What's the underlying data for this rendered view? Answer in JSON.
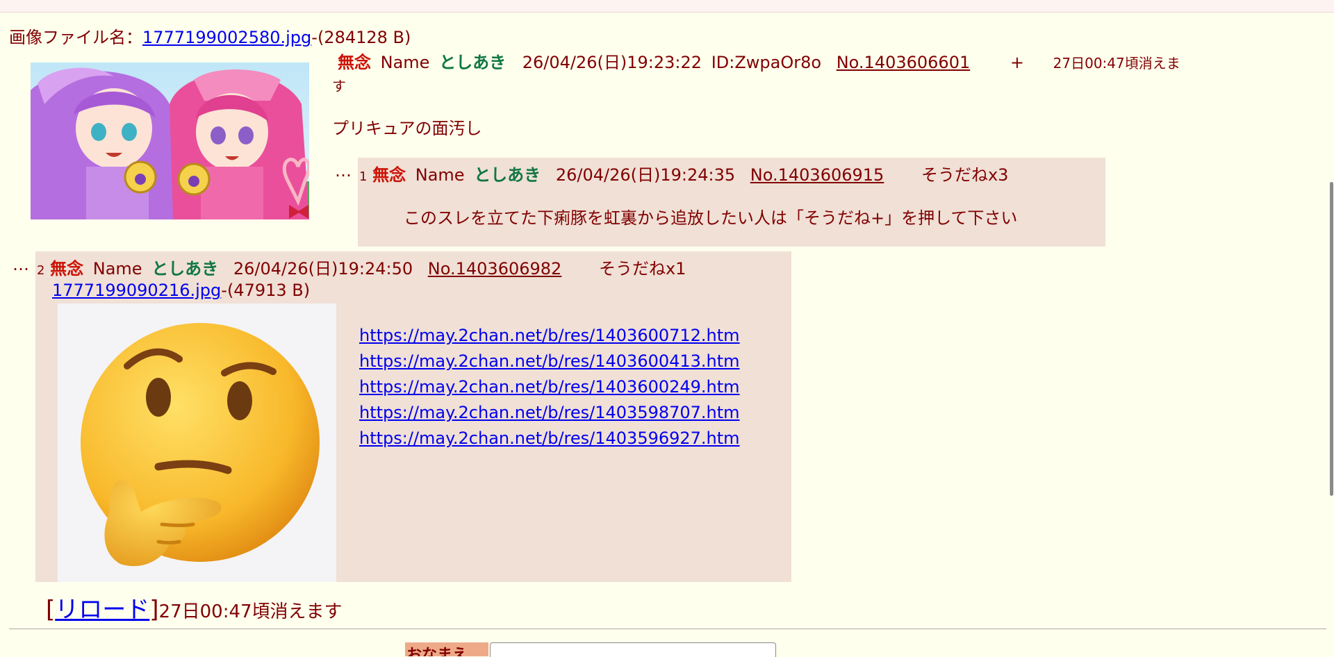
{
  "thread": {
    "file_prefix": "画像ファイル名：",
    "file_name": "1777199002580.jpg",
    "file_size": "-(284128 B)",
    "subject": "無念",
    "name_label": "Name",
    "name": "としあき",
    "date": "26/04/26(日)19:23:22",
    "id": "ID:ZwpaOr8o",
    "number": "No.1403606601",
    "plus": "+",
    "expire_1": "27日00:47頃消えま",
    "expire_2": "す",
    "body": "プリキュアの面汚し"
  },
  "replies": [
    {
      "prefix": "…",
      "index": "1",
      "subject": "無念",
      "name_label": "Name",
      "name": "としあき",
      "date": "26/04/26(日)19:24:35",
      "number": "No.1403606915",
      "soudane": "そうだねx3",
      "body": "このスレを立てた下痢豚を虹裏から追放したい人は「そうだね+」を押して下さい"
    },
    {
      "prefix": "…",
      "index": "2",
      "subject": "無念",
      "name_label": "Name",
      "name": "としあき",
      "date": "26/04/26(日)19:24:50",
      "number": "No.1403606982",
      "soudane": "そうだねx1",
      "file_name": "1777199090216.jpg",
      "file_size": "-(47913 B)",
      "links": [
        "https://may.2chan.net/b/res/1403600712.htm",
        "https://may.2chan.net/b/res/1403600413.htm",
        "https://may.2chan.net/b/res/1403600249.htm",
        "https://may.2chan.net/b/res/1403598707.htm",
        "https://may.2chan.net/b/res/1403596927.htm"
      ]
    }
  ],
  "footer": {
    "bracket_open": "[",
    "reload_label": "リロード",
    "bracket_close": "]",
    "expire": "27日00:47頃消えます"
  },
  "form": {
    "name_label": "おなまえ"
  },
  "colors": {
    "background": "#ffffee",
    "reply_background": "#f0e0d6",
    "text": "#800000",
    "subject": "#cc1105",
    "name": "#117743",
    "link": "#0000ee"
  }
}
